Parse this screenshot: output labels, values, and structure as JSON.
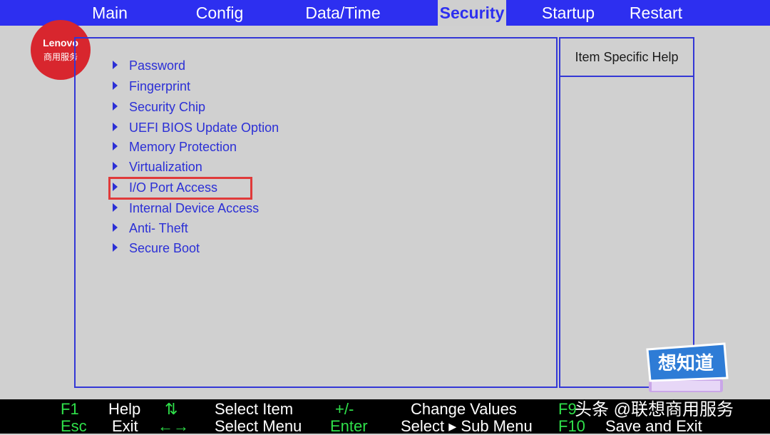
{
  "tabs": [
    {
      "label": "Main",
      "active": false
    },
    {
      "label": "Config",
      "active": false
    },
    {
      "label": "Data/Time",
      "active": false
    },
    {
      "label": "Security",
      "active": true
    },
    {
      "label": "Startup",
      "active": false
    },
    {
      "label": "Restart",
      "active": false
    }
  ],
  "logo": {
    "brand": "Lenovo",
    "subtitle": "商用服务"
  },
  "help": {
    "title": "Item Specific Help"
  },
  "menu": {
    "items": [
      {
        "label": "Password"
      },
      {
        "label": "Fingerprint"
      },
      {
        "label": "Security Chip"
      },
      {
        "label": "UEFI BIOS Update Option"
      },
      {
        "label": "Memory Protection"
      },
      {
        "label": "Virtualization"
      },
      {
        "label": "I/O Port Access",
        "highlighted": true
      },
      {
        "label": "Internal Device Access"
      },
      {
        "label": "Anti- Theft"
      },
      {
        "label": "Secure Boot"
      }
    ]
  },
  "footer": {
    "f1": "F1",
    "help": "Help",
    "updown": "⇅",
    "select_item": "Select Item",
    "plusminus": "+/-",
    "change_values": "Change Values",
    "f9": "F9",
    "esc": "Esc",
    "exit": "Exit",
    "leftright": "←→",
    "select_menu": "Select Menu",
    "enter": "Enter",
    "select_submenu": "Select ▸ Sub Menu",
    "f10": "F10",
    "save_exit": "Save and Exit"
  },
  "watermark": "头条 @联想商用服务",
  "sticker_text": "想知道",
  "colors": {
    "accent": "#2d2ff0",
    "highlight": "#e03a3a",
    "footer_key": "#2fe04a"
  }
}
